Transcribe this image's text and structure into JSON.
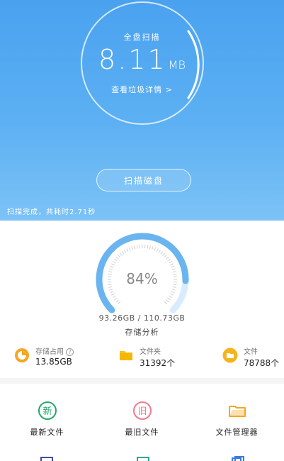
{
  "scan": {
    "title": "全盘扫描",
    "size_value": "8.11",
    "size_unit": "MB",
    "details_link": "查看垃圾详情 >",
    "button_label": "扫描磁盘",
    "status": "扫描完成，共耗时2.71秒"
  },
  "storage": {
    "percent_label": "84%",
    "percent_value": 84,
    "usage": "93.26GB / 110.73GB",
    "caption": "存储分析"
  },
  "stats": [
    {
      "label": "存储占用",
      "value": "13.85GB",
      "icon": "pie-chart-icon"
    },
    {
      "label": "文件夹",
      "value": "31392个",
      "icon": "folder-icon"
    },
    {
      "label": "文件",
      "value": "78788个",
      "icon": "file-icon"
    }
  ],
  "tools": [
    {
      "label": "最新文件",
      "icon": "new-files-icon"
    },
    {
      "label": "最旧文件",
      "icon": "old-files-icon"
    },
    {
      "label": "文件管理器",
      "icon": "file-manager-icon"
    }
  ],
  "colors": {
    "hero_blue": "#4aa2ef",
    "gauge_blue": "#6ab4f0",
    "green": "#22a86a",
    "pink": "#f07a8f",
    "orange": "#f5a623",
    "yellow": "#f7c21b"
  }
}
